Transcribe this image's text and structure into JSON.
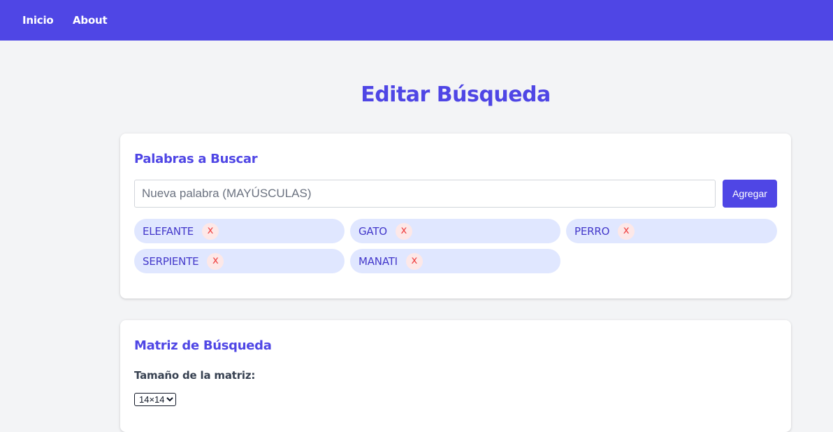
{
  "nav": {
    "items": [
      {
        "label": "Inicio"
      },
      {
        "label": "About"
      }
    ]
  },
  "page": {
    "title": "Editar Búsqueda"
  },
  "words_section": {
    "heading": "Palabras a Buscar",
    "input_placeholder": "Nueva palabra (MAYÚSCULAS)",
    "input_value": "",
    "add_label": "Agregar",
    "remove_label": "x",
    "words": [
      {
        "label": "ELEFANTE"
      },
      {
        "label": "GATO"
      },
      {
        "label": "PERRO"
      },
      {
        "label": "SERPIENTE"
      },
      {
        "label": "MANATI"
      }
    ]
  },
  "matrix_section": {
    "heading": "Matriz de Búsqueda",
    "size_label": "Tamaño de la matriz:",
    "size_selected": "14×14"
  },
  "colors": {
    "brand": "#4f46e5",
    "chip_bg": "#e0e7ff",
    "remove_x": "#ef4444",
    "page_bg": "#f3f4f6"
  }
}
